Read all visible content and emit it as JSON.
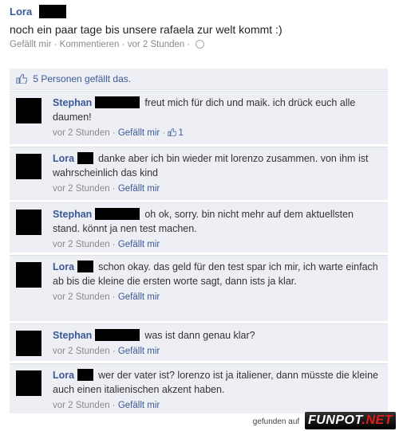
{
  "post": {
    "author": "Lora",
    "message": "noch ein paar tage bis unsere rafaela zur welt kommt :)",
    "like_link": "Gefällt mir",
    "comment_link": "Kommentieren",
    "time": "vor 2 Stunden",
    "sep": "·"
  },
  "likes": {
    "text": "5 Personen gefällt das."
  },
  "comments": [
    {
      "author": "Stephan",
      "text": "freut mich für dich und maik. ich drück euch alle daumen!",
      "time": "vor 2 Stunden",
      "like_link": "Gefällt mir",
      "like_count": "1"
    },
    {
      "author": "Lora",
      "text": "danke aber ich bin wieder mit lorenzo zusammen. von ihm ist wahrscheinlich das kind",
      "time": "vor 2 Stunden",
      "like_link": "Gefällt mir"
    },
    {
      "author": "Stephan",
      "text": "oh ok, sorry. bin nicht mehr auf dem aktuellsten stand. könnt ja nen test machen.",
      "time": "vor 2 Stunden",
      "like_link": "Gefällt mir"
    },
    {
      "author": "Lora",
      "text": "schon okay. das geld für den test spar ich mir, ich warte einfach ab bis die kleine die ersten worte sagt, dann ists ja klar.",
      "time": "vor 2 Stunden",
      "like_link": "Gefällt mir"
    },
    {
      "author": "Stephan",
      "text": "was ist dann genau klar?",
      "time": "vor 2 Stunden",
      "like_link": "Gefällt mir"
    },
    {
      "author": "Lora",
      "text": "wer der vater ist? lorenzo ist ja italiener, dann müsste die kleine auch einen italienischen akzent haben.",
      "time": "vor 2 Stunden",
      "like_link": "Gefällt mir"
    }
  ],
  "watermark": {
    "label": "gefunden auf",
    "brand_main": "FUNPOT",
    "brand_tld": ".NET"
  }
}
